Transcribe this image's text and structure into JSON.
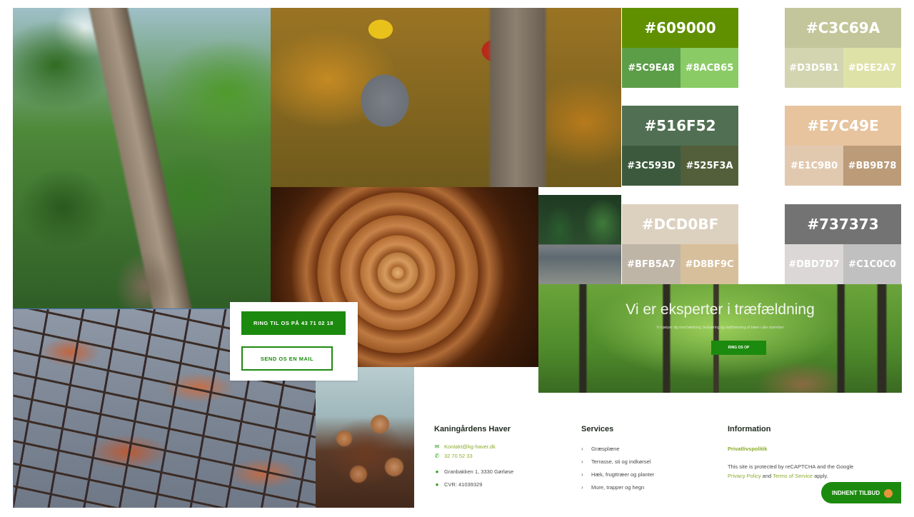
{
  "cta": {
    "call_label": "RING TIL OS PÅ 43 71 02 18",
    "mail_label": "SEND OS EN MAIL"
  },
  "hero": {
    "title": "Vi er eksperter i træfældning",
    "subtitle": "Vi hjælper dig med fældning, beskæring og stubfræsning af træer i alle størrelser",
    "button_label": "RING OS OP"
  },
  "palette": [
    {
      "main": "#609000",
      "main_color": "#609000",
      "subs": [
        {
          "label": "#5C9E48",
          "color": "#5C9E48"
        },
        {
          "label": "#8ACB65",
          "color": "#8ACB65"
        }
      ]
    },
    {
      "main": "#C3C69A",
      "main_color": "#C3C69A",
      "subs": [
        {
          "label": "#D3D5B1",
          "color": "#D3D5B1"
        },
        {
          "label": "#DEE2A7",
          "color": "#DEE2A7"
        }
      ]
    },
    {
      "main": "#516F52",
      "main_color": "#516F52",
      "subs": [
        {
          "label": "#3C593D",
          "color": "#3C593D"
        },
        {
          "label": "#525F3A",
          "color": "#525F3A"
        }
      ]
    },
    {
      "main": "#E7C49E",
      "main_color": "#E7C49E",
      "subs": [
        {
          "label": "#E1C9B0",
          "color": "#E1C9B0"
        },
        {
          "label": "#BB9B78",
          "color": "#BB9B78"
        }
      ]
    },
    {
      "main": "#DCD0BF",
      "main_color": "#DCD0BF",
      "subs": [
        {
          "label": "#BFB5A7",
          "color": "#BFB5A7"
        },
        {
          "label": "#D8BF9C",
          "color": "#D8BF9C"
        }
      ]
    },
    {
      "main": "#737373",
      "main_color": "#737373",
      "subs": [
        {
          "label": "#DBD7D7",
          "color": "#DBD7D7"
        },
        {
          "label": "#C1C0C0",
          "color": "#C1C0C0"
        }
      ]
    }
  ],
  "footer": {
    "company": {
      "heading": "Kaningårdens Haver",
      "email": "Kontakt@kg-haver.dk",
      "phone": "32 70 52 33",
      "address": "Granbakken 1, 3330 Gørløse",
      "cvr": "CVR: 41039329"
    },
    "services": {
      "heading": "Services",
      "items": [
        "Græsplæne",
        "Terrasse, sti og indkørsel",
        "Hæk, frugttræer og planter",
        "Mure, trapper og hegn"
      ]
    },
    "information": {
      "heading": "Information",
      "privacy_link": "Privatlivspolitik",
      "recaptcha_text": "This site is protected by reCAPTCHA and the Google",
      "privacy_policy_link": "Privacy Policy",
      "and_text": "and",
      "terms_link": "Terms of Service",
      "apply_text": "apply."
    }
  },
  "offer_button": {
    "label": "INDHENT TILBUD"
  }
}
